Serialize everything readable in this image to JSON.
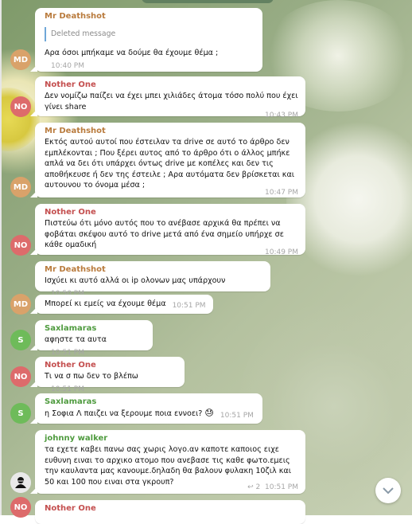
{
  "colors": {
    "md": "#d9a26a",
    "no": "#dd6b6b",
    "s": "#6ebb5a",
    "name_md": "#b97b3d",
    "name_no": "#c44f4f",
    "name_s": "#4f9b3f",
    "name_jw": "#4f9b3f"
  },
  "messages": [
    {
      "sender": "Mr Deathshot",
      "quote": "Deleted message",
      "text": "Αρα όσοι μπήκαμε να δούμε θα έχουμε θέμα ;",
      "time": "10:40 PM"
    },
    {
      "sender": "Nother One",
      "text": "Δεν νομίζω παίζει να έχει μπει χιλιάδες άτομα τόσο πολύ που έχει γίνει share",
      "time": "10:43 PM"
    },
    {
      "sender": "Mr Deathshot",
      "text": "Εκτός αυτού αυτοί που έστειλαν τα drive σε αυτό το άρθρο δεν εμπλέκονται ; Που ξέρει αυτος από το άρθρο ότι ο άλλος μπήκε απλά να δει ότι υπάρχει όντως drive με κοπέλες και δεν τις αποθήκευσε ή δεν της έστειλε ; Αρα αυτόματα δεν βρίσκεται και αυτουνου το όνομα μέσα ;",
      "time": "10:47 PM"
    },
    {
      "sender": "Nother One",
      "text": "Πιστεύω ότι μόνο αυτός που το ανέβασε αρχικά θα πρέπει να φοβάται σκέψου αυτό το drive μετά από ένα σημείο υπήρχε σε κάθε ομαδική",
      "time": "10:49 PM"
    },
    {
      "sender": "Mr Deathshot",
      "text": "Ισχύει κι αυτό αλλά οι ip ολονων μας υπάρχουν",
      "time": "10:50 PM"
    },
    {
      "text": "Μπορεί κι εμείς να έχουμε θέμα",
      "time": "10:51 PM"
    },
    {
      "sender": "Saxlamaras",
      "text": "αφηστε τα αυτα",
      "time": "10:51 PM"
    },
    {
      "sender": "Nother One",
      "text": "Τι να σ πω δεν το βλέπω",
      "time": "10:51 PM"
    },
    {
      "sender": "Saxlamaras",
      "text": "η Σοφια Λ παιζει να ξερουμε ποια εννοει?",
      "emoji": "😓",
      "time": "10:51 PM"
    },
    {
      "sender": "johnny walker",
      "text": "τα εχετε καβει πανω σας χωρις λογο.αν καποτε καποιος ειχε ευθυνη ειναι το αρχικο ατομο που ανεβασε τις καθε φωτο.εμεις την καυλαντα μας κανουμε.δηλαδη θα βαλουν φυλακη 10ζιλ και 50 και 100 που ειναι στα γκρουπ?",
      "replies": "2",
      "time": "10:51 PM"
    },
    {
      "sender": "Nother One"
    }
  ],
  "avatars": {
    "md": "MD",
    "no": "NO",
    "s": "S"
  }
}
